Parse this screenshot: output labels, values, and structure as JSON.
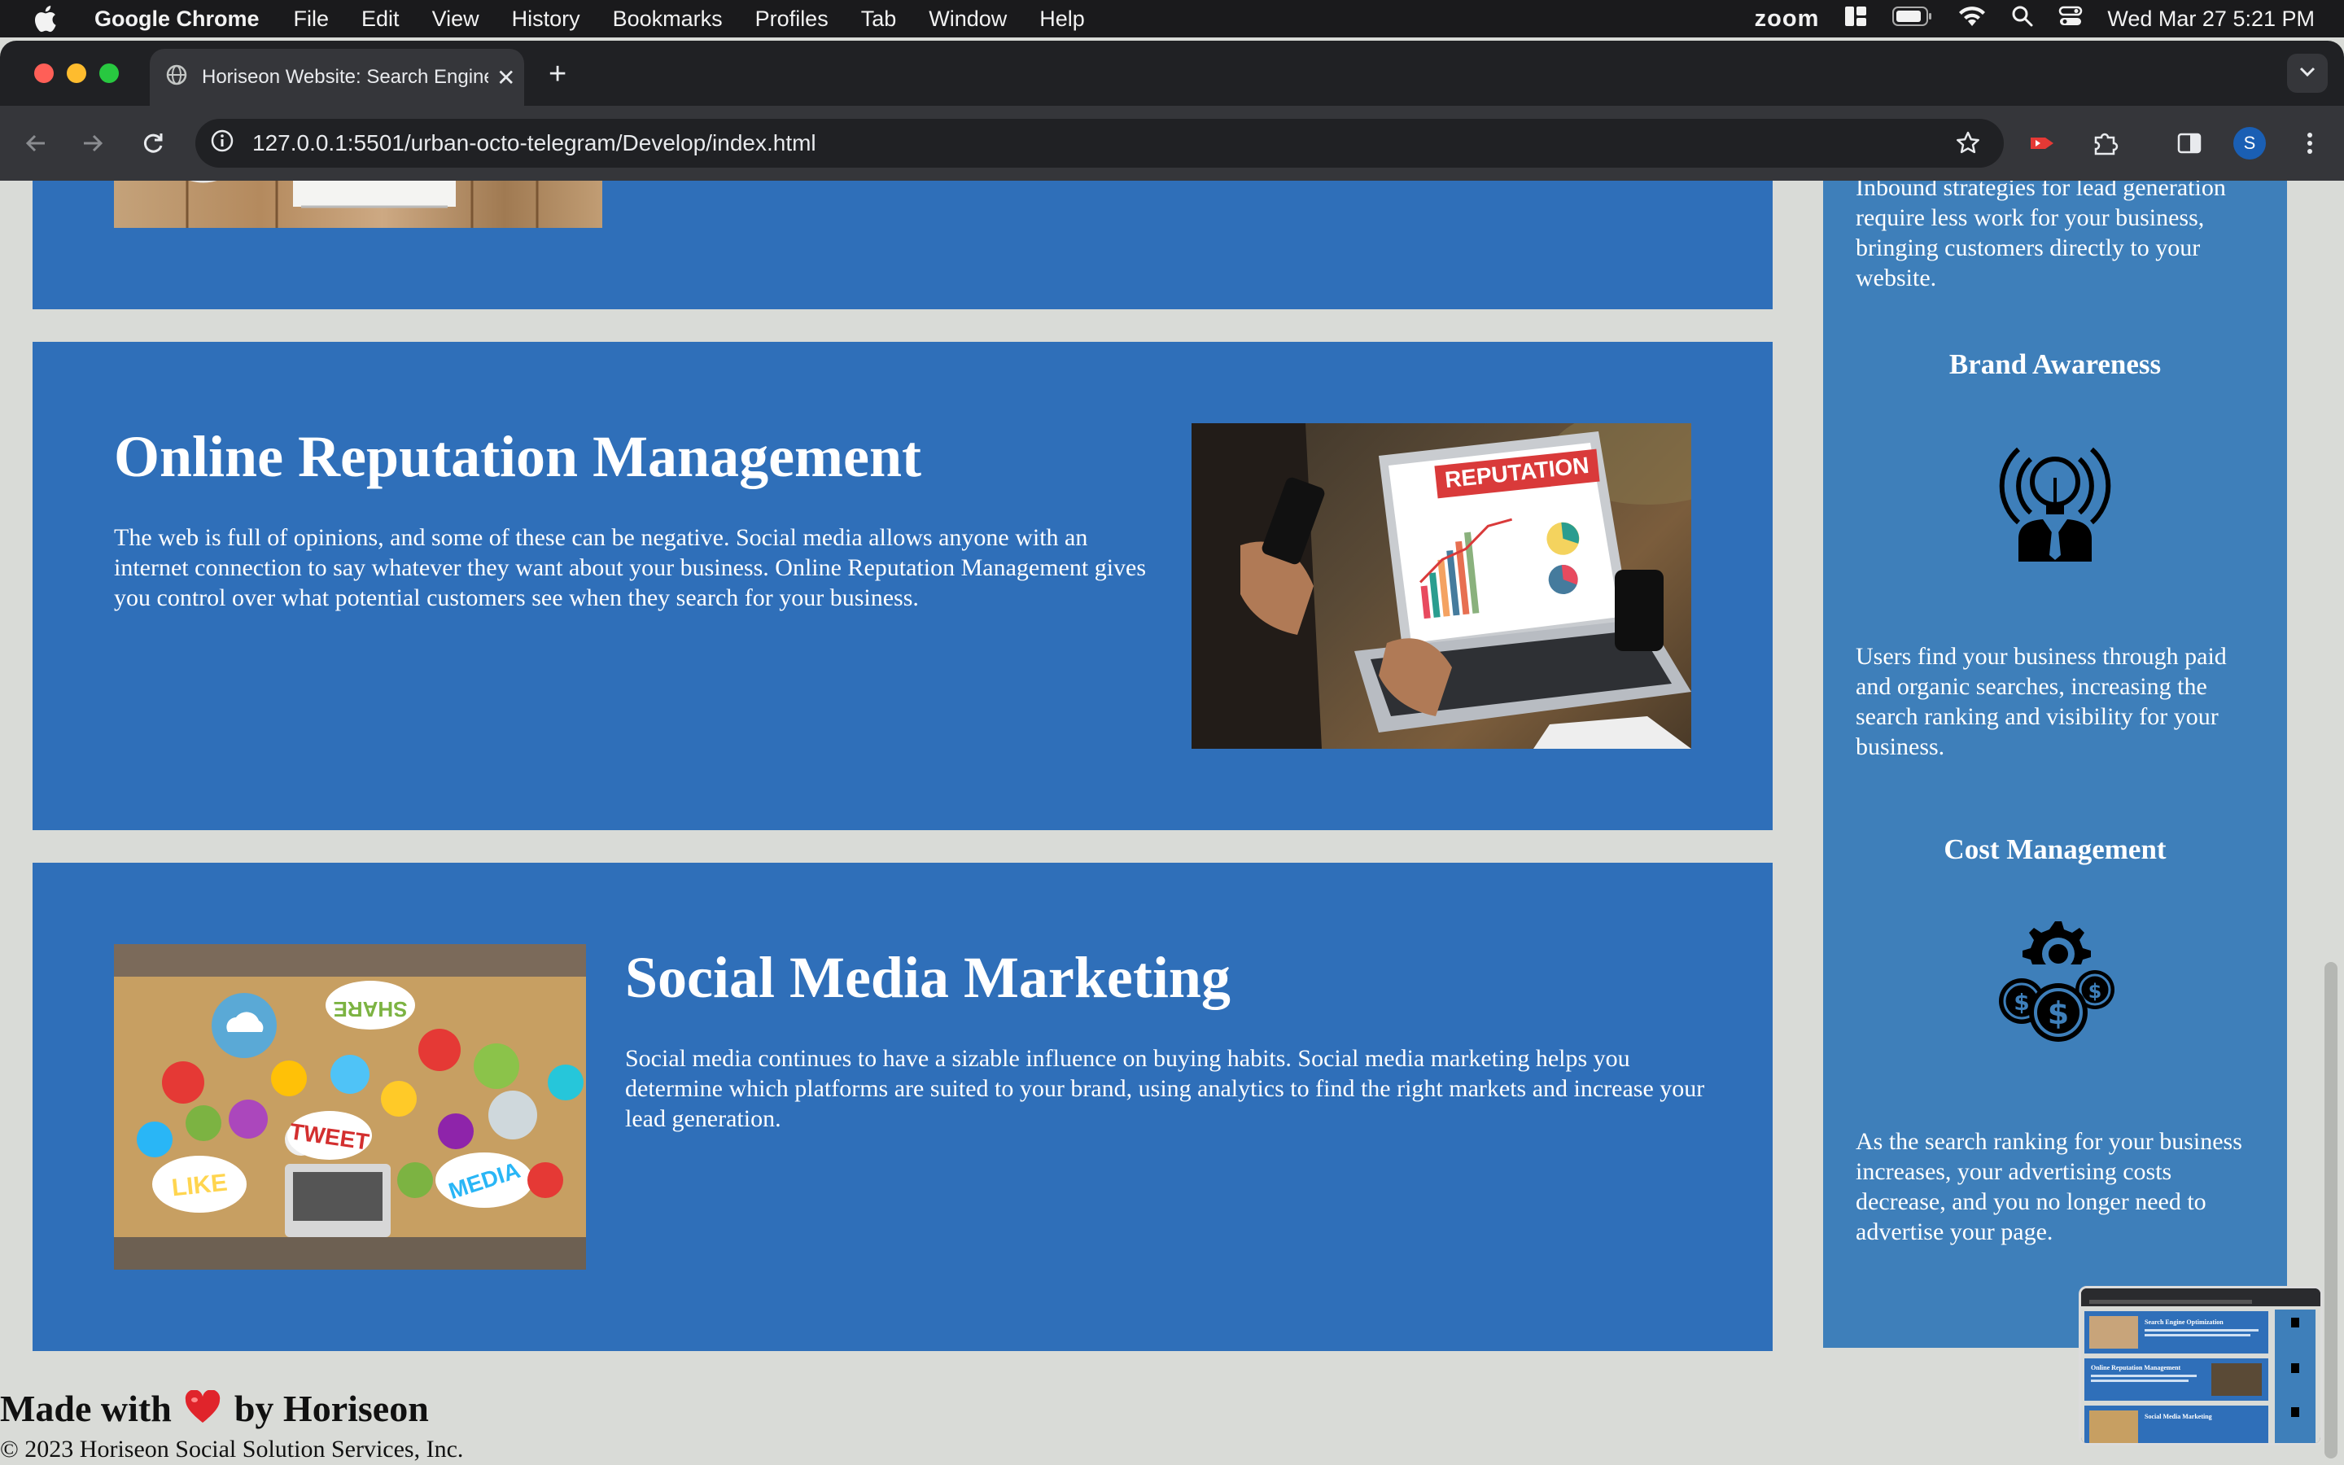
{
  "menubar": {
    "app_name": "Google Chrome",
    "items": [
      "File",
      "Edit",
      "View",
      "History",
      "Bookmarks",
      "Profiles",
      "Tab",
      "Window",
      "Help"
    ],
    "zoom_label": "zoom",
    "datetime": "Wed Mar 27  5:21 PM"
  },
  "browser": {
    "tab_title": "Horiseon Website: Search Engine Optimization",
    "url": "127.0.0.1:5501/urban-octo-telegram/Develop/index.html",
    "profile_initial": "S"
  },
  "page": {
    "reputation": {
      "heading": "Online Reputation Management",
      "body": "The web is full of opinions, and some of these can be negative. Social media allows anyone with an internet connection to say whatever they want about your business. Online Reputation Management gives you control over what potential customers see when they search for your business.",
      "image_text": "REPUTATION"
    },
    "social": {
      "heading": "Social Media Marketing",
      "body": "Social media continues to have a sizable influence on buying habits. Social media marketing helps you determine which platforms are suited to your brand, using analytics to find the right markets and increase your lead generation.",
      "image_words": [
        "SHARE",
        "TWEET",
        "LIKE",
        "MEDIA"
      ]
    },
    "sidebar": {
      "lead_partial": "Inbound strategies for lead generation require less work for your business, bringing customers directly to your website.",
      "brand_heading": "Brand Awareness",
      "brand_body": "Users find your business through paid and organic searches, increasing the search ranking and visibility for your business.",
      "cost_heading": "Cost Management",
      "cost_body": "As the search ranking for your business increases, your advertising costs decrease, and you no longer need to advertise your page."
    },
    "footer": {
      "made_prefix": "Made with",
      "made_suffix": "by Horiseon",
      "copyright": "© 2023 Horiseon Social Solution Services, Inc."
    }
  },
  "thumbnail": {
    "labels": [
      "Search Engine Optimization",
      "Online Reputation Management",
      "Social Media Marketing"
    ]
  },
  "colors": {
    "card": "#2f6fb9",
    "sidebar": "#3e7fba",
    "page_bg": "#d9dbd7"
  }
}
